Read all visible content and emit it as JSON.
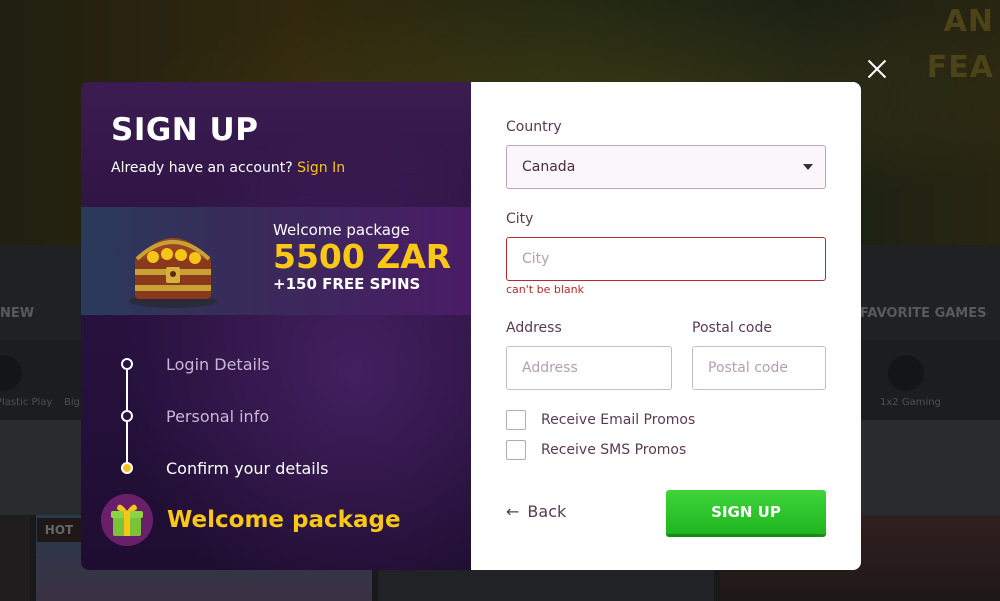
{
  "background": {
    "hero_text": [
      "AN",
      "FEA"
    ],
    "categories": [
      "NEW",
      "FAVORITE GAMES"
    ],
    "providers": [
      "Plastic Play",
      "Big Time Gaming",
      "1x2 Gaming"
    ],
    "hot_badge": "HOT"
  },
  "modal": {
    "close_icon": "close-icon",
    "left": {
      "title": "SIGN UP",
      "have_account": "Already have an account?",
      "signin_link": "Sign In",
      "promo": {
        "small": "Welcome package",
        "big": "5500 ZAR",
        "spins": "+150 FREE SPINS",
        "image": "treasure-chest"
      },
      "steps": [
        {
          "label": "Login Details",
          "state": "done"
        },
        {
          "label": "Personal info",
          "state": "done"
        },
        {
          "label": "Confirm your details",
          "state": "active"
        }
      ],
      "welcome_label": "Welcome package",
      "welcome_icon": "gift-icon"
    },
    "form": {
      "country": {
        "label": "Country",
        "value": "Canada"
      },
      "city": {
        "label": "City",
        "placeholder": "City",
        "value": "",
        "error": "can't be blank"
      },
      "address": {
        "label": "Address",
        "placeholder": "Address",
        "value": ""
      },
      "postal": {
        "label": "Postal code",
        "placeholder": "Postal code",
        "value": ""
      },
      "email_promos": {
        "label": "Receive Email Promos",
        "checked": false
      },
      "sms_promos": {
        "label": "Receive SMS Promos",
        "checked": false
      },
      "back_label": "Back",
      "submit_label": "SIGN UP"
    }
  },
  "colors": {
    "accent_yellow": "#f7c31a",
    "error_red": "#b32b2b",
    "submit_green": "#22b622",
    "left_panel_purple": "#2b1240"
  }
}
